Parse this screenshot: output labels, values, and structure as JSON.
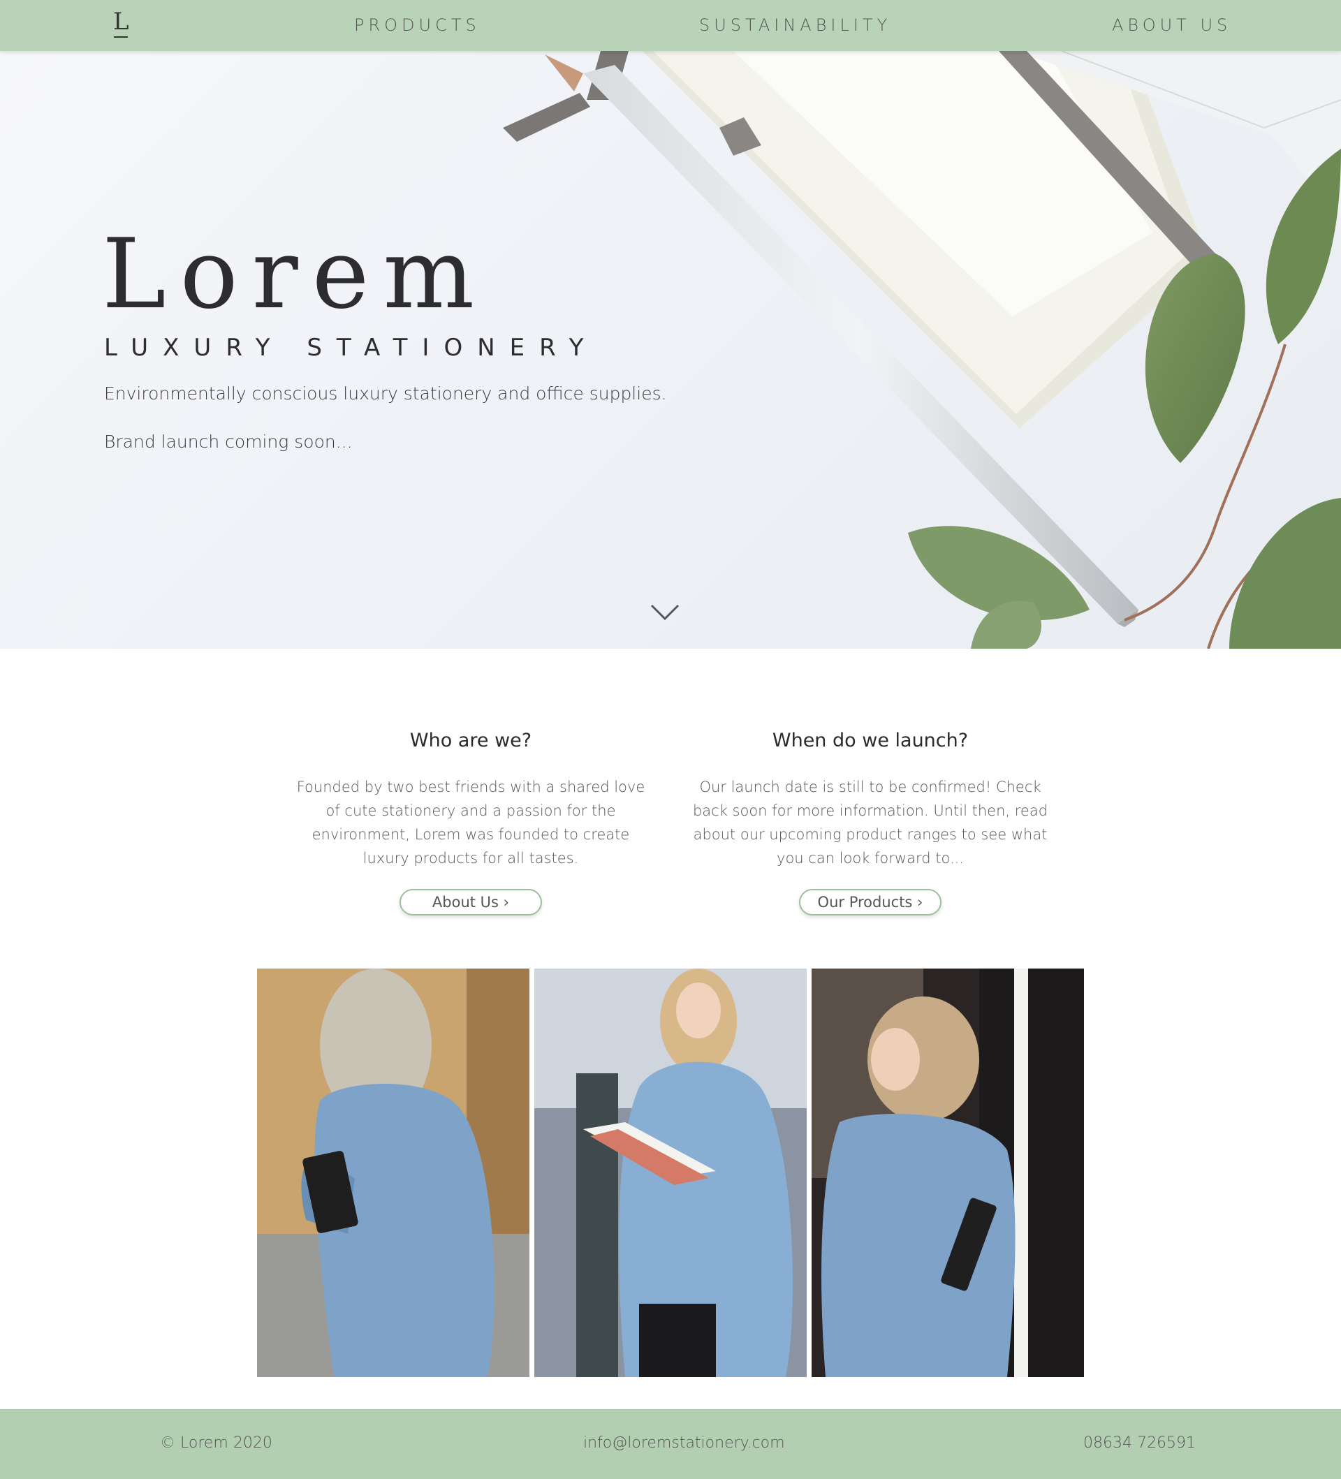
{
  "nav": {
    "logo": "L",
    "links": [
      {
        "label": "PRODUCTS"
      },
      {
        "label": "SUSTAINABILITY"
      },
      {
        "label": "ABOUT US"
      }
    ]
  },
  "hero": {
    "title": "Lorem",
    "subtitle": "LUXURY STATIONERY",
    "description": "Environmentally conscious luxury stationery and office supplies.",
    "launch_note": "Brand launch coming soon...",
    "scroll_icon": "chevron-down-icon"
  },
  "info": {
    "left": {
      "heading": "Who are we?",
      "body": "Founded by two best friends with a shared love of cute stationery and a passion for the environment, Lorem was founded to create luxury products for all tastes.",
      "button": "About Us ›"
    },
    "right": {
      "heading": "When do we launch?",
      "body": "Our launch date is still to be confirmed! Check back soon for more information. Until then, read about our upcoming product ranges to see what you can look forward to...",
      "button": "Our Products ›"
    }
  },
  "gallery": {
    "images": [
      "woman-denim-jacket-notebook-back",
      "woman-reading-pink-notebook",
      "woman-smiling-holding-notebook"
    ]
  },
  "footer": {
    "copyright": "© Lorem 2020",
    "email": "info@loremstationery.com",
    "phone": "08634 726591"
  },
  "colors": {
    "nav_bg": "#b9d3b9",
    "footer_bg": "#b2cfb2",
    "accent_border": "#9cc09c",
    "text_dark": "#2d2d2f"
  }
}
